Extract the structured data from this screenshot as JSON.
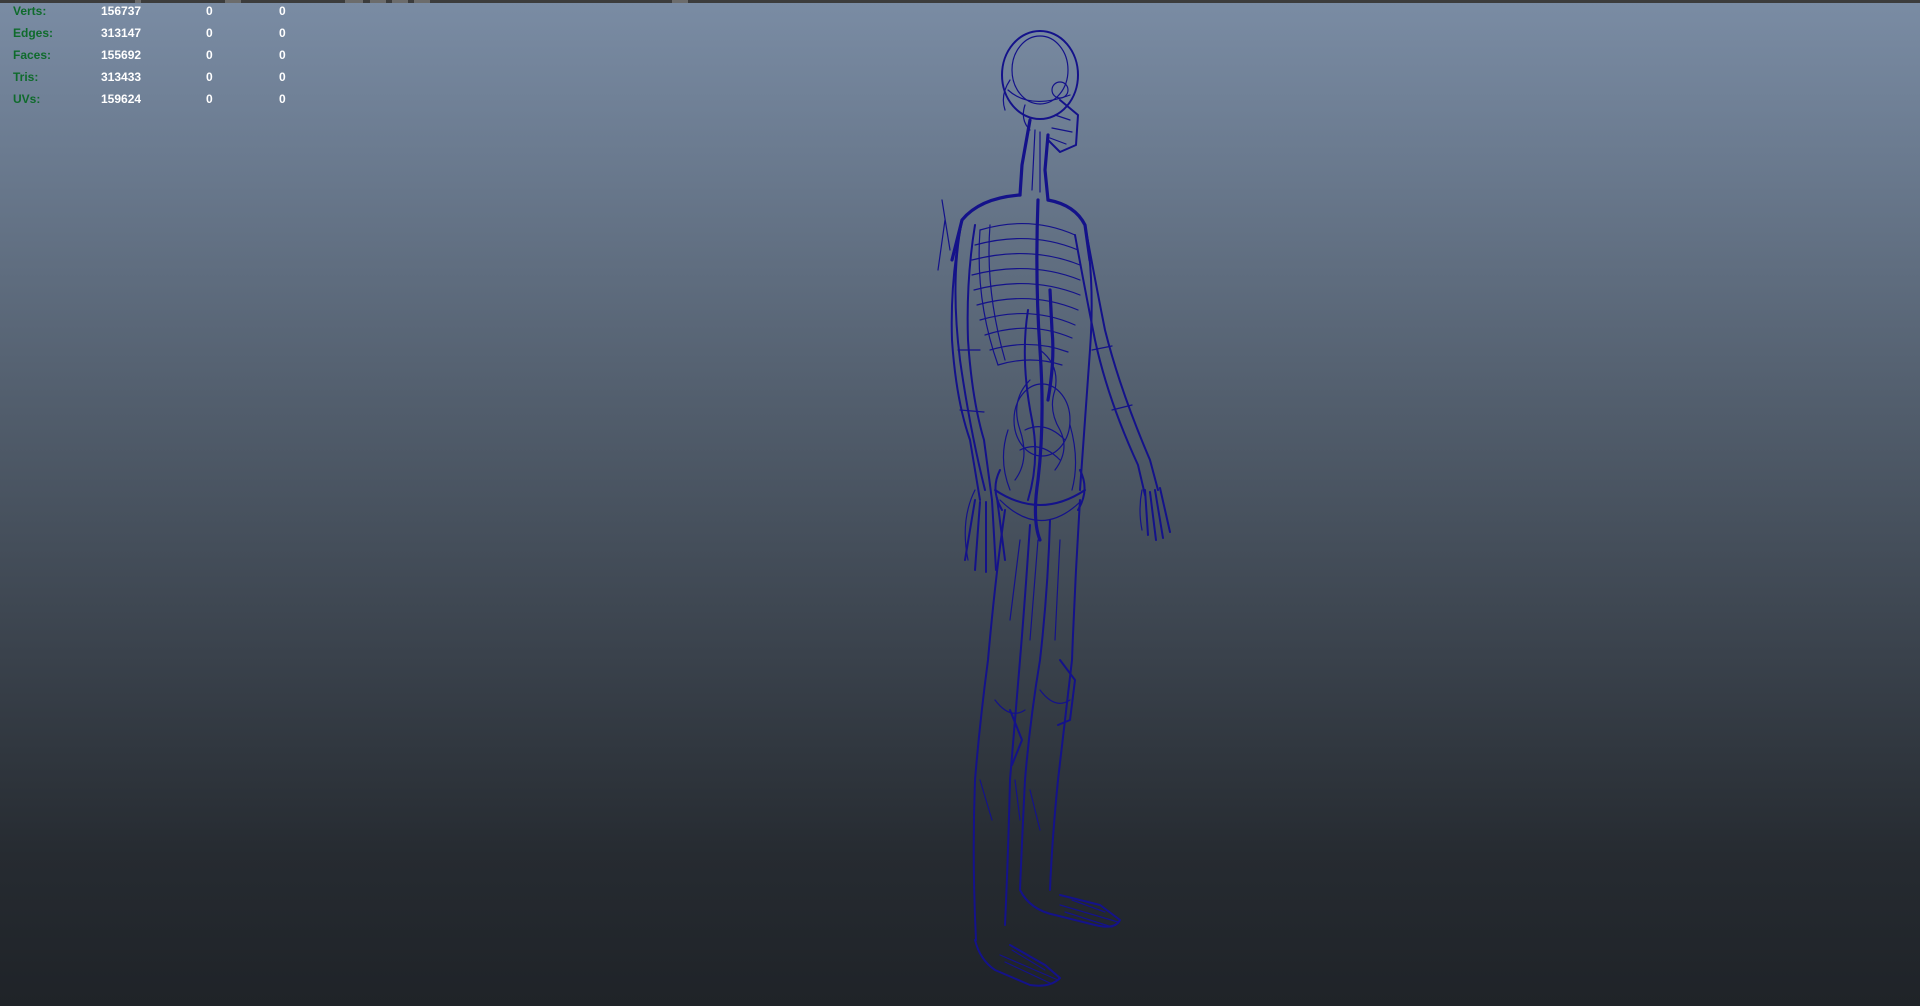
{
  "hud": {
    "rows": [
      {
        "label": "Verts:",
        "total": "156737",
        "selected": "0",
        "third": "0"
      },
      {
        "label": "Edges:",
        "total": "313147",
        "selected": "0",
        "third": "0"
      },
      {
        "label": "Faces:",
        "total": "155692",
        "selected": "0",
        "third": "0"
      },
      {
        "label": "Tris:",
        "total": "313433",
        "selected": "0",
        "third": "0"
      },
      {
        "label": "UVs:",
        "total": "159624",
        "selected": "0",
        "third": "0"
      }
    ]
  },
  "colors": {
    "hud_label": "#0f6b2c",
    "hud_value": "#ffffff",
    "wireframe": "#14128a",
    "gradient_top": "#7a8ca4",
    "gradient_bottom": "#1f2328"
  }
}
